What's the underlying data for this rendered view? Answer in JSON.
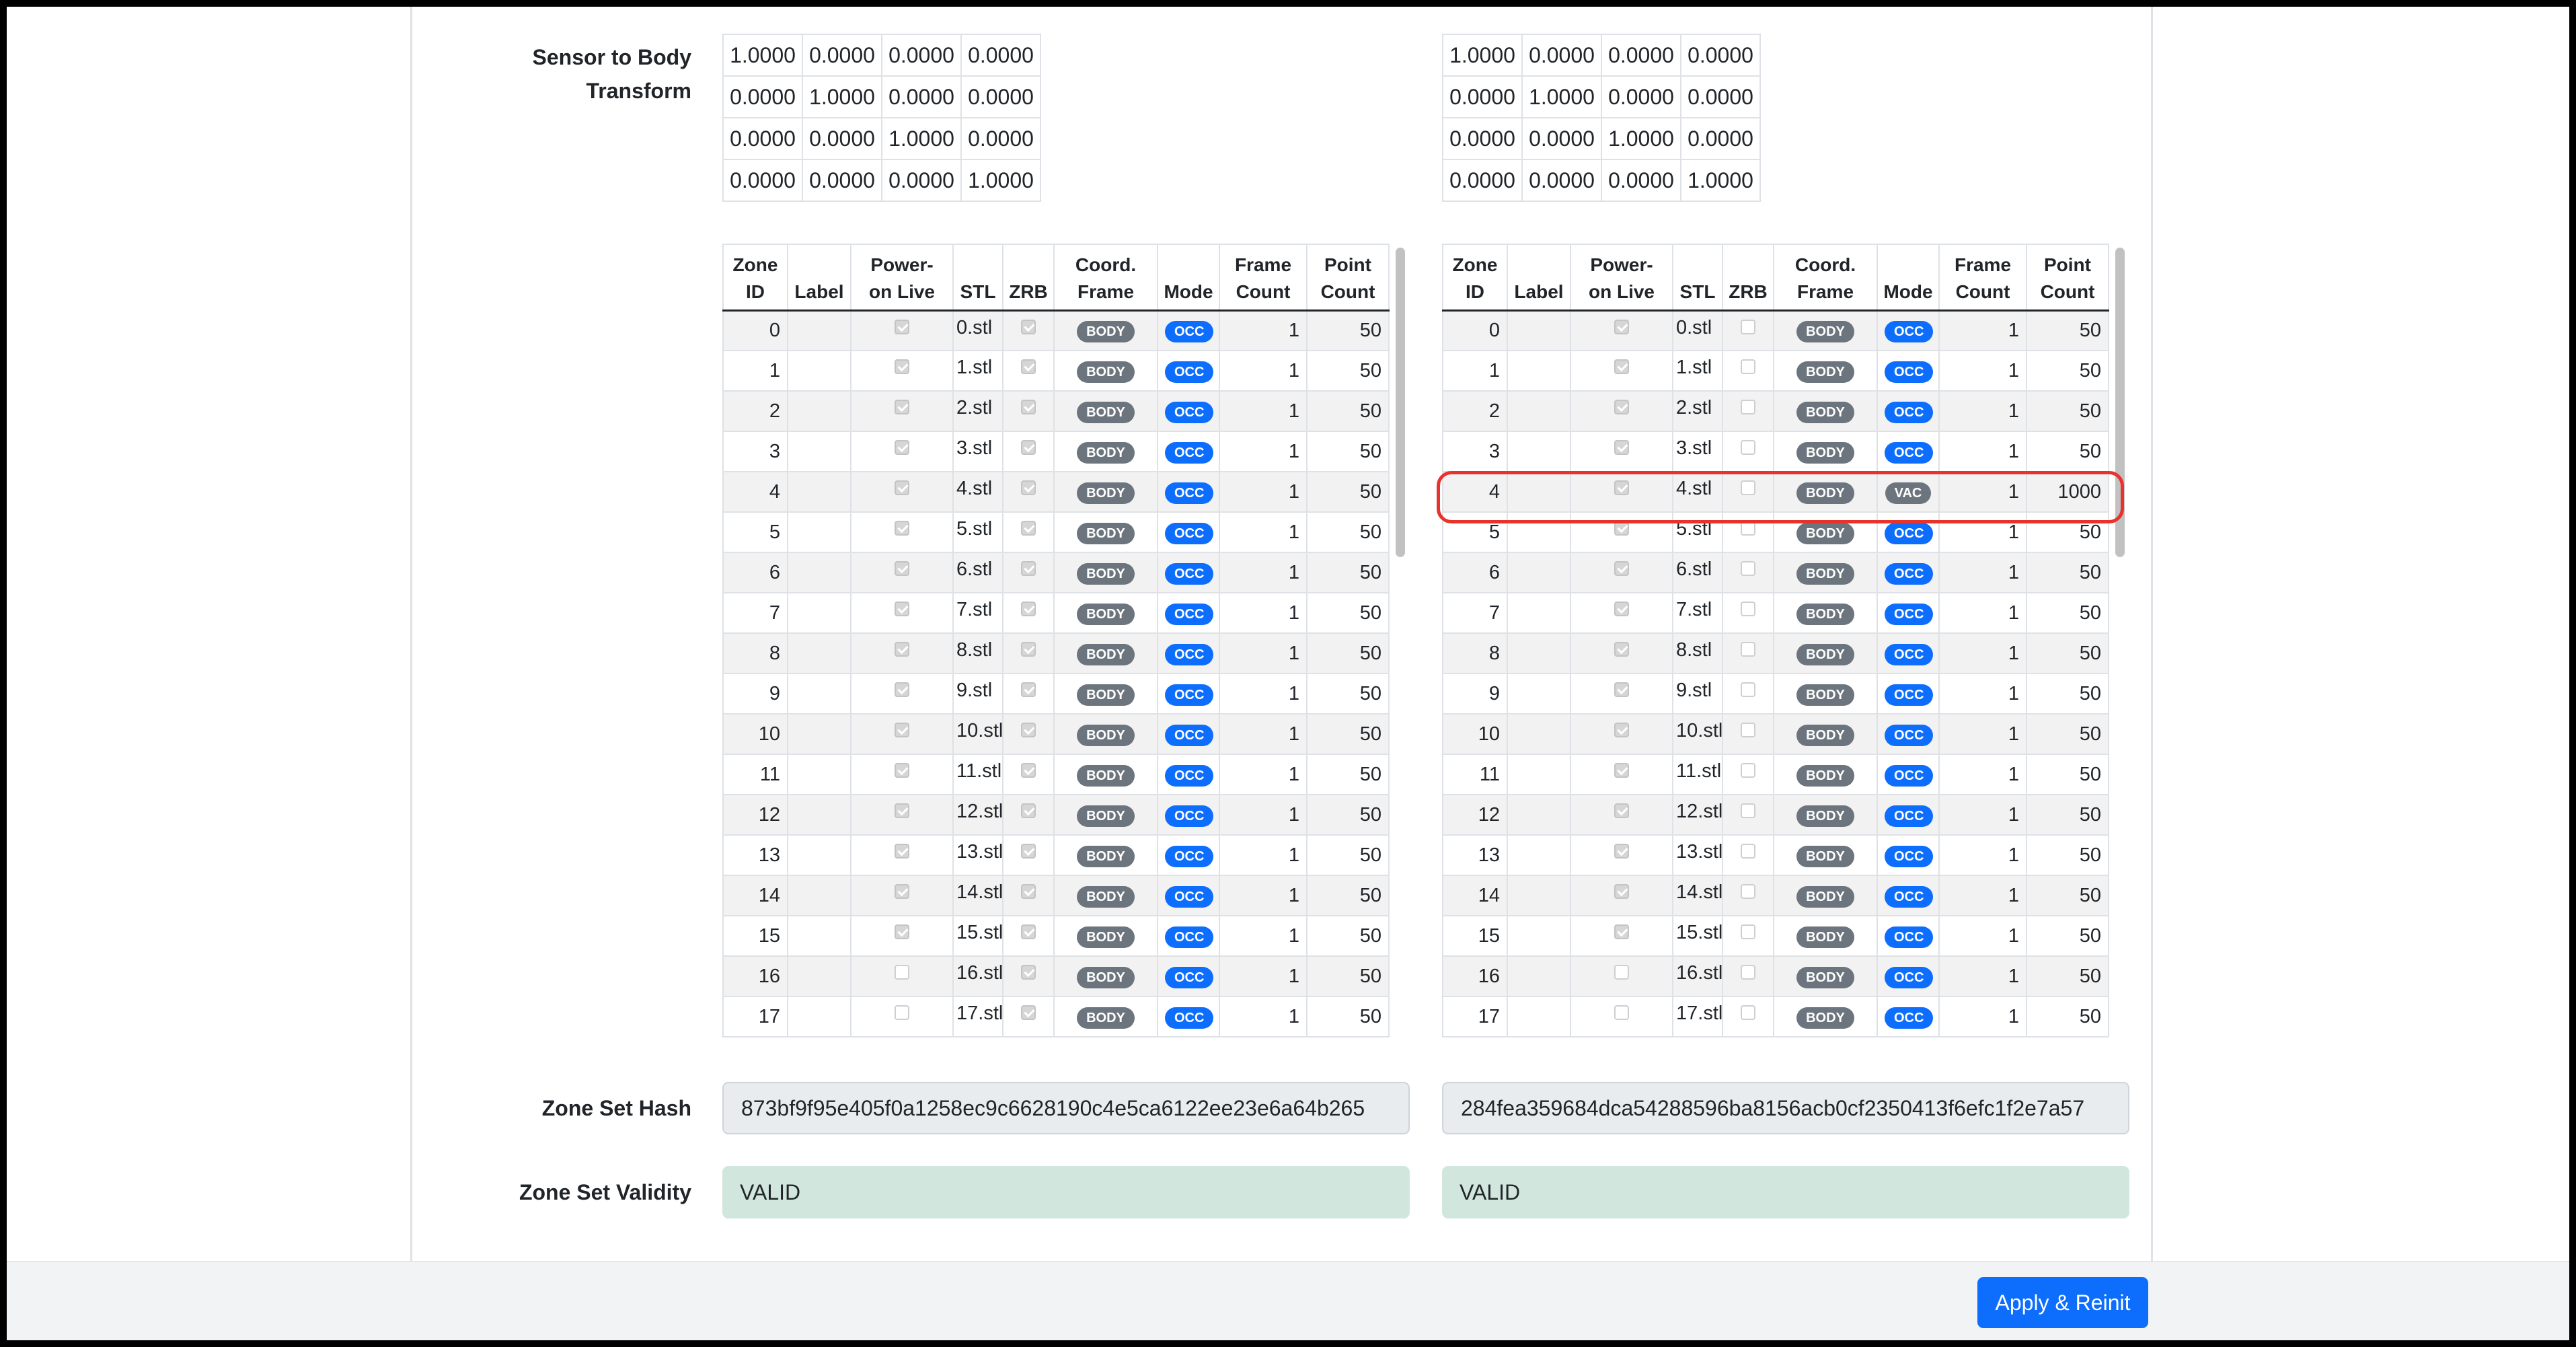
{
  "labels": {
    "transform_line1": "Sensor to Body",
    "transform_line2": "Transform",
    "hash": "Zone Set Hash",
    "validity": "Zone Set Validity"
  },
  "headers": {
    "zone_id": [
      "Zone",
      "ID"
    ],
    "label": "Label",
    "power_on_live": [
      "Power-",
      "on Live"
    ],
    "stl": "STL",
    "zrb": "ZRB",
    "coord_frame": [
      "Coord.",
      "Frame"
    ],
    "mode": "Mode",
    "frame_count": [
      "Frame",
      "Count"
    ],
    "point_count": [
      "Point",
      "Count"
    ]
  },
  "left": {
    "matrix": [
      [
        "1.0000",
        "0.0000",
        "0.0000",
        "0.0000"
      ],
      [
        "0.0000",
        "1.0000",
        "0.0000",
        "0.0000"
      ],
      [
        "0.0000",
        "0.0000",
        "1.0000",
        "0.0000"
      ],
      [
        "0.0000",
        "0.0000",
        "0.0000",
        "1.0000"
      ]
    ],
    "zones": [
      {
        "id": "0",
        "label": "",
        "live": true,
        "stl": "0.stl",
        "zrb": true,
        "frame": "BODY",
        "mode": "OCC",
        "frames": "1",
        "points": "50"
      },
      {
        "id": "1",
        "label": "",
        "live": true,
        "stl": "1.stl",
        "zrb": true,
        "frame": "BODY",
        "mode": "OCC",
        "frames": "1",
        "points": "50"
      },
      {
        "id": "2",
        "label": "",
        "live": true,
        "stl": "2.stl",
        "zrb": true,
        "frame": "BODY",
        "mode": "OCC",
        "frames": "1",
        "points": "50"
      },
      {
        "id": "3",
        "label": "",
        "live": true,
        "stl": "3.stl",
        "zrb": true,
        "frame": "BODY",
        "mode": "OCC",
        "frames": "1",
        "points": "50"
      },
      {
        "id": "4",
        "label": "",
        "live": true,
        "stl": "4.stl",
        "zrb": true,
        "frame": "BODY",
        "mode": "OCC",
        "frames": "1",
        "points": "50"
      },
      {
        "id": "5",
        "label": "",
        "live": true,
        "stl": "5.stl",
        "zrb": true,
        "frame": "BODY",
        "mode": "OCC",
        "frames": "1",
        "points": "50"
      },
      {
        "id": "6",
        "label": "",
        "live": true,
        "stl": "6.stl",
        "zrb": true,
        "frame": "BODY",
        "mode": "OCC",
        "frames": "1",
        "points": "50"
      },
      {
        "id": "7",
        "label": "",
        "live": true,
        "stl": "7.stl",
        "zrb": true,
        "frame": "BODY",
        "mode": "OCC",
        "frames": "1",
        "points": "50"
      },
      {
        "id": "8",
        "label": "",
        "live": true,
        "stl": "8.stl",
        "zrb": true,
        "frame": "BODY",
        "mode": "OCC",
        "frames": "1",
        "points": "50"
      },
      {
        "id": "9",
        "label": "",
        "live": true,
        "stl": "9.stl",
        "zrb": true,
        "frame": "BODY",
        "mode": "OCC",
        "frames": "1",
        "points": "50"
      },
      {
        "id": "10",
        "label": "",
        "live": true,
        "stl": "10.stl",
        "zrb": true,
        "frame": "BODY",
        "mode": "OCC",
        "frames": "1",
        "points": "50"
      },
      {
        "id": "11",
        "label": "",
        "live": true,
        "stl": "11.stl",
        "zrb": true,
        "frame": "BODY",
        "mode": "OCC",
        "frames": "1",
        "points": "50"
      },
      {
        "id": "12",
        "label": "",
        "live": true,
        "stl": "12.stl",
        "zrb": true,
        "frame": "BODY",
        "mode": "OCC",
        "frames": "1",
        "points": "50"
      },
      {
        "id": "13",
        "label": "",
        "live": true,
        "stl": "13.stl",
        "zrb": true,
        "frame": "BODY",
        "mode": "OCC",
        "frames": "1",
        "points": "50"
      },
      {
        "id": "14",
        "label": "",
        "live": true,
        "stl": "14.stl",
        "zrb": true,
        "frame": "BODY",
        "mode": "OCC",
        "frames": "1",
        "points": "50"
      },
      {
        "id": "15",
        "label": "",
        "live": true,
        "stl": "15.stl",
        "zrb": true,
        "frame": "BODY",
        "mode": "OCC",
        "frames": "1",
        "points": "50"
      },
      {
        "id": "16",
        "label": "",
        "live": false,
        "stl": "16.stl",
        "zrb": true,
        "frame": "BODY",
        "mode": "OCC",
        "frames": "1",
        "points": "50"
      },
      {
        "id": "17",
        "label": "",
        "live": false,
        "stl": "17.stl",
        "zrb": true,
        "frame": "BODY",
        "mode": "OCC",
        "frames": "1",
        "points": "50"
      }
    ],
    "hash": "873bf9f95e405f0a1258ec9c6628190c4e5ca6122ee23e6a64b265",
    "validity": "VALID"
  },
  "right": {
    "matrix": [
      [
        "1.0000",
        "0.0000",
        "0.0000",
        "0.0000"
      ],
      [
        "0.0000",
        "1.0000",
        "0.0000",
        "0.0000"
      ],
      [
        "0.0000",
        "0.0000",
        "1.0000",
        "0.0000"
      ],
      [
        "0.0000",
        "0.0000",
        "0.0000",
        "1.0000"
      ]
    ],
    "zones": [
      {
        "id": "0",
        "label": "",
        "live": true,
        "stl": "0.stl",
        "zrb": false,
        "frame": "BODY",
        "mode": "OCC",
        "frames": "1",
        "points": "50"
      },
      {
        "id": "1",
        "label": "",
        "live": true,
        "stl": "1.stl",
        "zrb": false,
        "frame": "BODY",
        "mode": "OCC",
        "frames": "1",
        "points": "50"
      },
      {
        "id": "2",
        "label": "",
        "live": true,
        "stl": "2.stl",
        "zrb": false,
        "frame": "BODY",
        "mode": "OCC",
        "frames": "1",
        "points": "50"
      },
      {
        "id": "3",
        "label": "",
        "live": true,
        "stl": "3.stl",
        "zrb": false,
        "frame": "BODY",
        "mode": "OCC",
        "frames": "1",
        "points": "50"
      },
      {
        "id": "4",
        "label": "",
        "live": true,
        "stl": "4.stl",
        "zrb": false,
        "frame": "BODY",
        "mode": "VAC",
        "frames": "1",
        "points": "1000"
      },
      {
        "id": "5",
        "label": "",
        "live": true,
        "stl": "5.stl",
        "zrb": false,
        "frame": "BODY",
        "mode": "OCC",
        "frames": "1",
        "points": "50"
      },
      {
        "id": "6",
        "label": "",
        "live": true,
        "stl": "6.stl",
        "zrb": false,
        "frame": "BODY",
        "mode": "OCC",
        "frames": "1",
        "points": "50"
      },
      {
        "id": "7",
        "label": "",
        "live": true,
        "stl": "7.stl",
        "zrb": false,
        "frame": "BODY",
        "mode": "OCC",
        "frames": "1",
        "points": "50"
      },
      {
        "id": "8",
        "label": "",
        "live": true,
        "stl": "8.stl",
        "zrb": false,
        "frame": "BODY",
        "mode": "OCC",
        "frames": "1",
        "points": "50"
      },
      {
        "id": "9",
        "label": "",
        "live": true,
        "stl": "9.stl",
        "zrb": false,
        "frame": "BODY",
        "mode": "OCC",
        "frames": "1",
        "points": "50"
      },
      {
        "id": "10",
        "label": "",
        "live": true,
        "stl": "10.stl",
        "zrb": false,
        "frame": "BODY",
        "mode": "OCC",
        "frames": "1",
        "points": "50"
      },
      {
        "id": "11",
        "label": "",
        "live": true,
        "stl": "11.stl",
        "zrb": false,
        "frame": "BODY",
        "mode": "OCC",
        "frames": "1",
        "points": "50"
      },
      {
        "id": "12",
        "label": "",
        "live": true,
        "stl": "12.stl",
        "zrb": false,
        "frame": "BODY",
        "mode": "OCC",
        "frames": "1",
        "points": "50"
      },
      {
        "id": "13",
        "label": "",
        "live": true,
        "stl": "13.stl",
        "zrb": false,
        "frame": "BODY",
        "mode": "OCC",
        "frames": "1",
        "points": "50"
      },
      {
        "id": "14",
        "label": "",
        "live": true,
        "stl": "14.stl",
        "zrb": false,
        "frame": "BODY",
        "mode": "OCC",
        "frames": "1",
        "points": "50"
      },
      {
        "id": "15",
        "label": "",
        "live": true,
        "stl": "15.stl",
        "zrb": false,
        "frame": "BODY",
        "mode": "OCC",
        "frames": "1",
        "points": "50"
      },
      {
        "id": "16",
        "label": "",
        "live": false,
        "stl": "16.stl",
        "zrb": false,
        "frame": "BODY",
        "mode": "OCC",
        "frames": "1",
        "points": "50"
      },
      {
        "id": "17",
        "label": "",
        "live": false,
        "stl": "17.stl",
        "zrb": false,
        "frame": "BODY",
        "mode": "OCC",
        "frames": "1",
        "points": "50"
      }
    ],
    "hash": "284fea359684dca54288596ba8156acb0cf2350413f6efc1f2e7a57",
    "validity": "VALID"
  },
  "highlighted_zone": "4",
  "footer": {
    "apply_label": "Apply & Reinit"
  },
  "colors": {
    "primary": "#0d6efd",
    "badge_body": "#6c757d",
    "badge_occ": "#0d6efd",
    "badge_vac": "#6c757d",
    "valid_bg": "#d1e7dd",
    "highlight": "#e8322c"
  }
}
